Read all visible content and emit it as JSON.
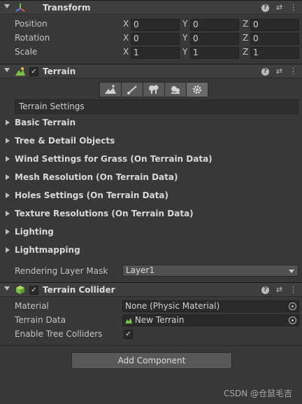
{
  "transform": {
    "title": "Transform",
    "rows": [
      {
        "label": "Position",
        "x": "0",
        "y": "0",
        "z": "0"
      },
      {
        "label": "Rotation",
        "x": "0",
        "y": "0",
        "z": "0"
      },
      {
        "label": "Scale",
        "x": "1",
        "y": "1",
        "z": "1"
      }
    ],
    "axis_labels": {
      "x": "X",
      "y": "Y",
      "z": "Z"
    }
  },
  "terrain": {
    "title": "Terrain",
    "enabled": true,
    "tool_icons": [
      "raise-terrain-icon",
      "paint-brush-icon",
      "place-trees-icon",
      "paint-details-icon",
      "terrain-settings-icon"
    ],
    "active_tool_index": 4,
    "settings_label": "Terrain Settings",
    "sections": [
      "Basic Terrain",
      "Tree & Detail Objects",
      "Wind Settings for Grass (On Terrain Data)",
      "Mesh Resolution (On Terrain Data)",
      "Holes Settings (On Terrain Data)",
      "Texture Resolutions (On Terrain Data)",
      "Lighting",
      "Lightmapping"
    ],
    "rendering_layer_mask": {
      "label": "Rendering Layer Mask",
      "value": "Layer1"
    }
  },
  "terrain_collider": {
    "title": "Terrain Collider",
    "enabled": true,
    "material": {
      "label": "Material",
      "value": "None (Physic Material)"
    },
    "terrain_data": {
      "label": "Terrain Data",
      "value": "New Terrain"
    },
    "enable_tree_colliders": {
      "label": "Enable Tree Colliders",
      "checked": true
    }
  },
  "add_component_label": "Add Component",
  "header_icons": {
    "help": "?",
    "settings": "⇄",
    "menu": "⋮"
  },
  "check_glyph": "✓",
  "watermark": "CSDN @仓鼠毛吉",
  "colors": {
    "background": "#383838",
    "header": "#3e3e3e",
    "field": "#2a2a2a",
    "accent_green": "#7bc142"
  }
}
